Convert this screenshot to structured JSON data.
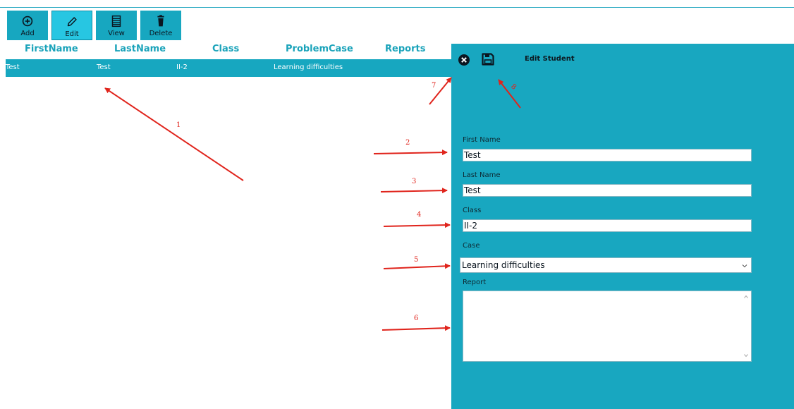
{
  "toolbar": {
    "buttons": [
      {
        "label": "Add",
        "icon": "plus-circle-icon"
      },
      {
        "label": "Edit",
        "icon": "pencil-icon",
        "active": true
      },
      {
        "label": "View",
        "icon": "list-icon"
      },
      {
        "label": "Delete",
        "icon": "trash-icon"
      }
    ]
  },
  "table": {
    "columns": [
      "FirstName",
      "LastName",
      "Class",
      "ProblemCase",
      "Reports"
    ],
    "rows": [
      {
        "first_name": "Test",
        "last_name": "Test",
        "class": "II-2",
        "problem_case": "Learning difficulties",
        "report": ""
      }
    ]
  },
  "edit_panel": {
    "title": "Edit Student",
    "close_icon": "close-circle-icon",
    "save_icon": "floppy-disk-icon",
    "fields": {
      "first_name_label": "First Name",
      "first_name_value": "Test",
      "last_name_label": "Last Name",
      "last_name_value": "Test",
      "class_label": "Class",
      "class_value": "II-2",
      "case_label": "Case",
      "case_value": "Learning difficulties",
      "report_label": "Report",
      "report_value": ""
    }
  },
  "annotations": [
    "1",
    "2",
    "3",
    "4",
    "5",
    "6",
    "7",
    "8"
  ],
  "colors": {
    "accent": "#18a7c0",
    "active_button": "#27c6e2",
    "header_text": "#1aa3ba",
    "annotation": "#e0241c"
  }
}
